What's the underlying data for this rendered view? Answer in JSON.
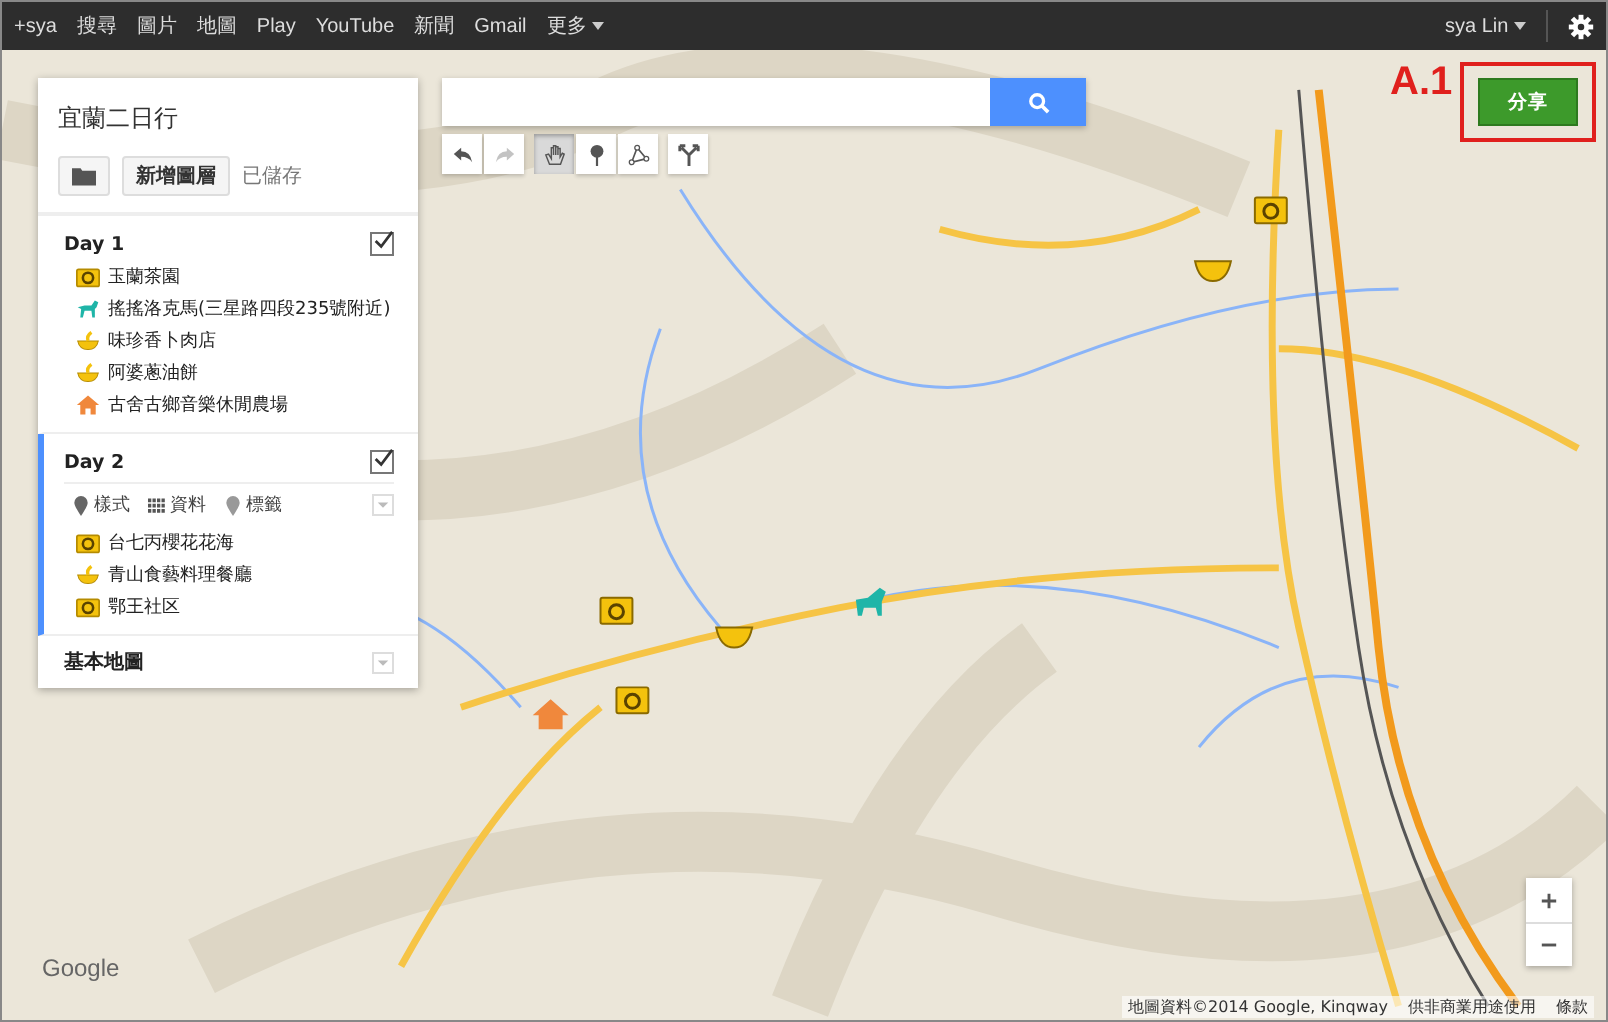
{
  "topbar": {
    "links": [
      "+sya",
      "搜尋",
      "圖片",
      "地圖",
      "Play",
      "YouTube",
      "新聞",
      "Gmail"
    ],
    "more": "更多",
    "user": "sya Lin"
  },
  "map": {
    "title": "宜蘭二日行",
    "saved": "已儲存",
    "add_layer": "新增圖層",
    "layers": [
      {
        "title": "Day 1",
        "selected": false,
        "checked": true,
        "items": [
          {
            "kind": "camera",
            "name": "玉蘭茶園"
          },
          {
            "kind": "horse",
            "name": "搖搖洛克馬(三星路四段235號附近)"
          },
          {
            "kind": "food",
            "name": "味珍香卜肉店"
          },
          {
            "kind": "food",
            "name": "阿婆蔥油餅"
          },
          {
            "kind": "house",
            "name": "古舍古鄉音樂休閒農場"
          }
        ]
      },
      {
        "title": "Day 2",
        "selected": true,
        "checked": true,
        "options": [
          {
            "kind": "style",
            "label": "樣式"
          },
          {
            "kind": "data",
            "label": "資料"
          },
          {
            "kind": "label",
            "label": "標籤"
          }
        ],
        "items": [
          {
            "kind": "camera",
            "name": "台七丙櫻花花海"
          },
          {
            "kind": "food",
            "name": "青山食藝料理餐廳"
          },
          {
            "kind": "camera",
            "name": "鄂王社区"
          }
        ]
      }
    ],
    "base_map": "基本地圖"
  },
  "tools": [
    {
      "kind": "undo",
      "disabled": false,
      "selected": false
    },
    {
      "kind": "redo",
      "disabled": true,
      "selected": false
    },
    {
      "kind": "hand",
      "disabled": false,
      "selected": true
    },
    {
      "kind": "marker",
      "disabled": false,
      "selected": false
    },
    {
      "kind": "line",
      "disabled": false,
      "selected": false
    },
    {
      "kind": "directions",
      "disabled": false,
      "selected": false
    }
  ],
  "share": "分享",
  "annotation": "A.1",
  "footer": {
    "logo": "Google",
    "attribution": "地圖資料©2014 Google, Kinqway",
    "usage": "供非商業用途使用",
    "terms": "條款"
  }
}
